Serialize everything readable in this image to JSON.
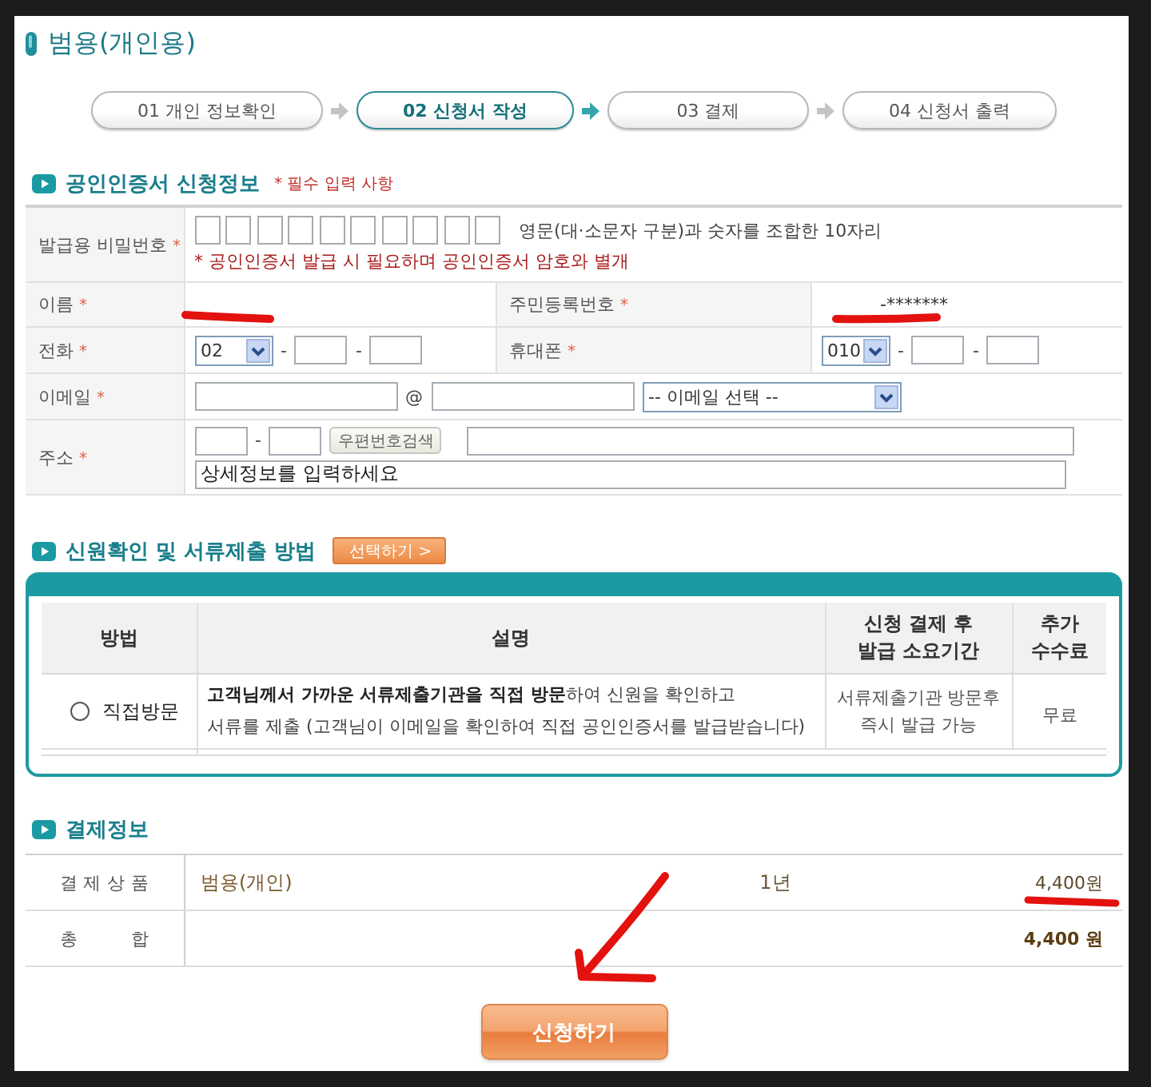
{
  "page_title": "범용(개인용)",
  "steps": [
    {
      "label": "01 개인 정보확인",
      "selected": false
    },
    {
      "label": "02 신청서 작성",
      "selected": true
    },
    {
      "label": "03 결제",
      "selected": false
    },
    {
      "label": "04 신청서 출력",
      "selected": false
    }
  ],
  "application": {
    "title": "공인인증서 신청정보",
    "required_note": "* 필수 입력 사항",
    "password": {
      "label": "발급용 비밀번호",
      "mark": "*",
      "boxes": [
        {
          "filled": false
        },
        {
          "filled": false
        },
        {
          "filled": false
        },
        {
          "filled": false
        },
        {
          "filled": false
        },
        {
          "filled": false
        },
        {
          "filled": false
        },
        {
          "filled": false
        },
        {
          "filled": false
        },
        {
          "filled": false
        }
      ],
      "hint": "영문(대·소문자 구분)과 숫자를 조합한 10자리",
      "note": "* 공인인증서 발급 시 필요하며 공인인증서 암호와 별개"
    },
    "name": {
      "label": "이름",
      "mark": "*"
    },
    "resident_number": {
      "label": "주민등록번호",
      "mark": "*",
      "value": "-*******"
    },
    "phone": {
      "label": "전화",
      "mark": "*",
      "area_code": "02",
      "separators": [
        "-",
        "-"
      ]
    },
    "mobile": {
      "label": "휴대폰",
      "mark": "*",
      "prefix": "010",
      "separators": [
        "-",
        "-"
      ]
    },
    "email": {
      "label": "이메일",
      "mark": "*",
      "at": "@",
      "domain_select": "-- 이메일 선택 --"
    },
    "address": {
      "label": "주소",
      "mark": "*",
      "separator": "-",
      "zip_button": "우편번호검색",
      "detail": "상세정보를 입력하세요"
    }
  },
  "method": {
    "title": "신원확인 및 서류제출 방법",
    "select_button": "선택하기 >",
    "columns": [
      "방법",
      "설명",
      "신청 결제 후 발급 소요기간",
      "추가 수수료"
    ],
    "rows": [
      {
        "method": "직접방문",
        "selected": false,
        "description": "**고객님께서 가까운 서류제출기관을 직접 방문**하여 신원을 확인하고\n서류를 제출 (고객님이 이메일을 확인하여 직접 공인인증서를 발급받습니다)",
        "period": "서류제출기관 방문후 즉시 발급 가능",
        "fee": "무료"
      }
    ]
  },
  "payment": {
    "title": "결제정보",
    "rows": [
      {
        "label": "결 제 상 품",
        "product": "범용(개인)",
        "term": "1년",
        "price": "4,400원"
      }
    ],
    "total": {
      "label": "총 합",
      "value": "4,400 원"
    }
  },
  "submit_button": "신청하기"
}
